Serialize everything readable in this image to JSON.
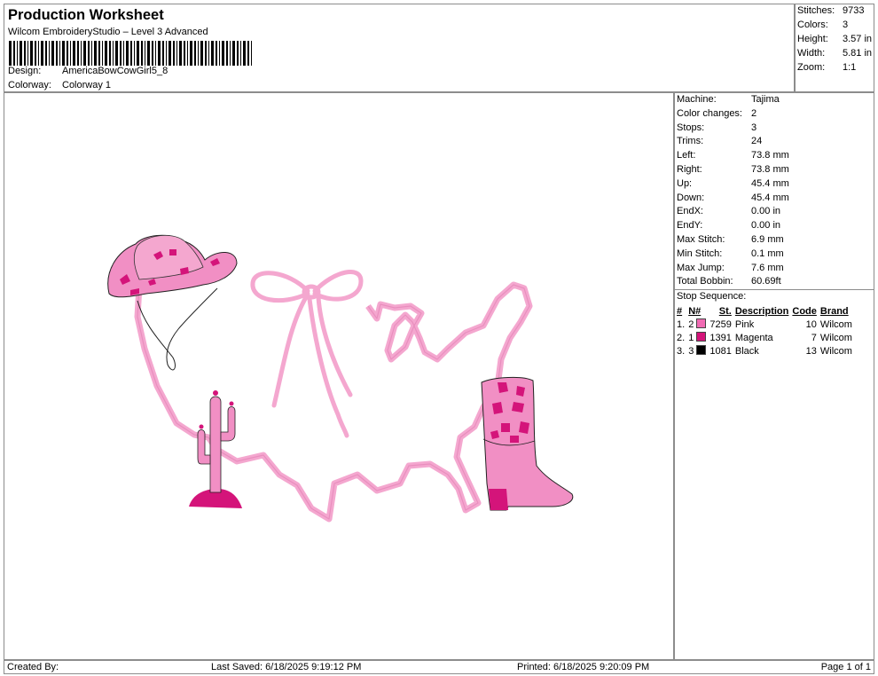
{
  "header": {
    "title": "Production Worksheet",
    "subtitle": "Wilcom EmbroideryStudio – Level 3 Advanced",
    "design_label": "Design:",
    "design_value": "AmericaBowCowGirl5_8",
    "colorway_label": "Colorway:",
    "colorway_value": "Colorway 1"
  },
  "stats": [
    {
      "label": "Stitches:",
      "value": "9733"
    },
    {
      "label": "Colors:",
      "value": "3"
    },
    {
      "label": "Height:",
      "value": "3.57 in"
    },
    {
      "label": "Width:",
      "value": "5.81 in"
    },
    {
      "label": "Zoom:",
      "value": "1:1"
    }
  ],
  "machine_info": [
    {
      "label": "Machine:",
      "value": "Tajima"
    },
    {
      "label": "Color changes:",
      "value": "2"
    },
    {
      "label": "Stops:",
      "value": "3"
    },
    {
      "label": "Trims:",
      "value": "24"
    },
    {
      "label": "Left:",
      "value": "73.8 mm"
    },
    {
      "label": "Right:",
      "value": "73.8 mm"
    },
    {
      "label": "Up:",
      "value": "45.4 mm"
    },
    {
      "label": "Down:",
      "value": "45.4 mm"
    },
    {
      "label": "EndX:",
      "value": "0.00 in"
    },
    {
      "label": "EndY:",
      "value": "0.00 in"
    },
    {
      "label": "Max Stitch:",
      "value": "6.9 mm"
    },
    {
      "label": "Min Stitch:",
      "value": "0.1 mm"
    },
    {
      "label": "Max Jump:",
      "value": "7.6 mm"
    },
    {
      "label": "Total Bobbin:",
      "value": "60.69ft"
    }
  ],
  "stop_sequence": {
    "label": "Stop Sequence:",
    "headers": {
      "num": "#",
      "n": "N#",
      "st": "St.",
      "description": "Description",
      "code": "Code",
      "brand": "Brand"
    },
    "rows": [
      {
        "num": "1.",
        "n": "2",
        "st": "7259",
        "description": "Pink",
        "code": "10",
        "brand": "Wilcom",
        "color": "#f06bb3"
      },
      {
        "num": "2.",
        "n": "1",
        "st": "1391",
        "description": "Magenta",
        "code": "7",
        "brand": "Wilcom",
        "color": "#d4147a"
      },
      {
        "num": "3.",
        "n": "3",
        "st": "1081",
        "description": "Black",
        "code": "13",
        "brand": "Wilcom",
        "color": "#000000"
      }
    ]
  },
  "footer": {
    "created_by": "Created By:",
    "last_saved": "Last Saved: 6/18/2025 9:19:12 PM",
    "printed": "Printed: 6/18/2025 9:20:09 PM",
    "page": "Page 1 of 1"
  },
  "colors": {
    "pink_light": "#f4a7cf",
    "pink": "#e97fb8",
    "magenta": "#d4147a",
    "black": "#000000"
  }
}
